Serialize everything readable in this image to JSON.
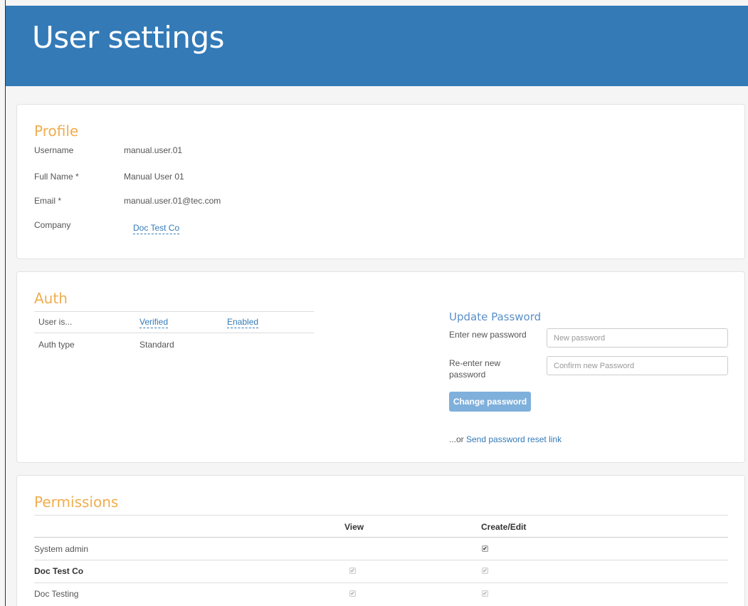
{
  "page": {
    "title": "User settings"
  },
  "profile": {
    "title": "Profile",
    "fields": [
      {
        "label": "Username",
        "value": "manual.user.01"
      },
      {
        "label": "Full Name *",
        "value": "Manual User 01"
      },
      {
        "label": "Email *",
        "value": "manual.user.01@tec.com"
      },
      {
        "label": "Company",
        "value": "Doc Test Co"
      }
    ]
  },
  "auth": {
    "title": "Auth",
    "user_is_label": "User is...",
    "verified": "Verified",
    "enabled": "Enabled",
    "auth_type_label": "Auth type",
    "auth_type_value": "Standard",
    "update_password": {
      "title": "Update Password",
      "new_label": "Enter new password",
      "new_placeholder": "New password",
      "confirm_label": "Re-enter new password",
      "confirm_placeholder": "Confirm new Password",
      "button": "Change password",
      "or_text": "...or",
      "reset_link": "Send password reset link"
    }
  },
  "permissions": {
    "title": "Permissions",
    "columns": [
      "",
      "View",
      "Create/Edit"
    ],
    "rows": [
      {
        "name": "System admin",
        "bold": false,
        "view": null,
        "edit": true
      },
      {
        "name": "Doc Test Co",
        "bold": true,
        "view": true,
        "edit": true
      },
      {
        "name": "Doc Testing",
        "bold": false,
        "view": true,
        "edit": true
      }
    ]
  },
  "colors": {
    "header": "#337ab7",
    "accent": "#f0ad4e",
    "link": "#337ab7"
  }
}
